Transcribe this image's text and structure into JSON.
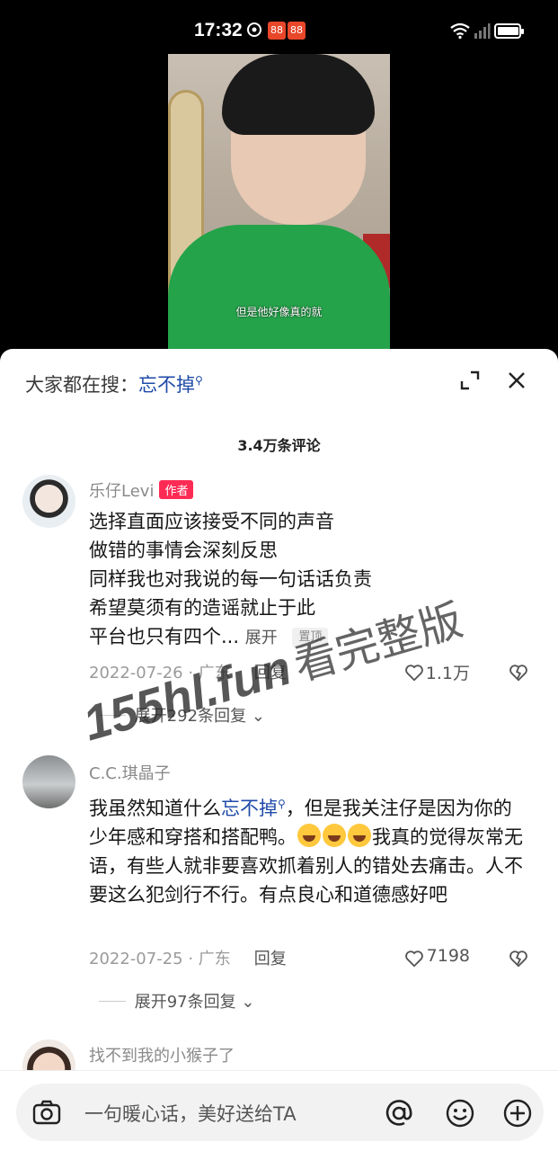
{
  "status_bar": {
    "time": "17:32",
    "badges": [
      "88",
      "88"
    ]
  },
  "video": {
    "subtitle": "但是他好像真的就"
  },
  "comments_panel": {
    "search_prefix": "大家都在搜：",
    "search_term": "忘不掉",
    "comment_count": "3.4万条评论",
    "comments": [
      {
        "username": "乐仔Levi",
        "badge": "作者",
        "lines": [
          "选择直面应该接受不同的声音",
          "做错的事情会深刻反思",
          "同样我也对我说的每一句话话负责",
          "希望莫须有的造谣就止于此",
          "平台也只有四个..."
        ],
        "more_label": "展开",
        "pinned_label": "置顶",
        "date": "2022-07-26",
        "location": "广东",
        "reply_label": "回复",
        "likes": "1.1万",
        "expand_label": "展开292条回复"
      },
      {
        "username": "C.C.琪晶子",
        "text_before": "我虽然知道什么",
        "text_link": "忘不掉",
        "text_after": "，但是我关注仔是因为你的少年感和穿搭和搭配鸭。",
        "text_end": "我真的觉得灰常无语，有些人就非要喜欢抓着别人的错处去痛击。人不要这么犯剑行不行。有点良心和道德感好吧",
        "date": "2022-07-25",
        "location": "广东",
        "reply_label": "回复",
        "likes": "7198",
        "expand_label": "展开97条回复"
      },
      {
        "username": "找不到我的小猴子了"
      }
    ]
  },
  "watermark": {
    "domain": "155hl.fun",
    "text": "看完整版"
  },
  "input_bar": {
    "placeholder": "一句暖心话，美好送给TA"
  },
  "colors": {
    "link": "#1f4aa8",
    "author_badge": "#fe2c55",
    "status_badge": "#e8472a"
  }
}
